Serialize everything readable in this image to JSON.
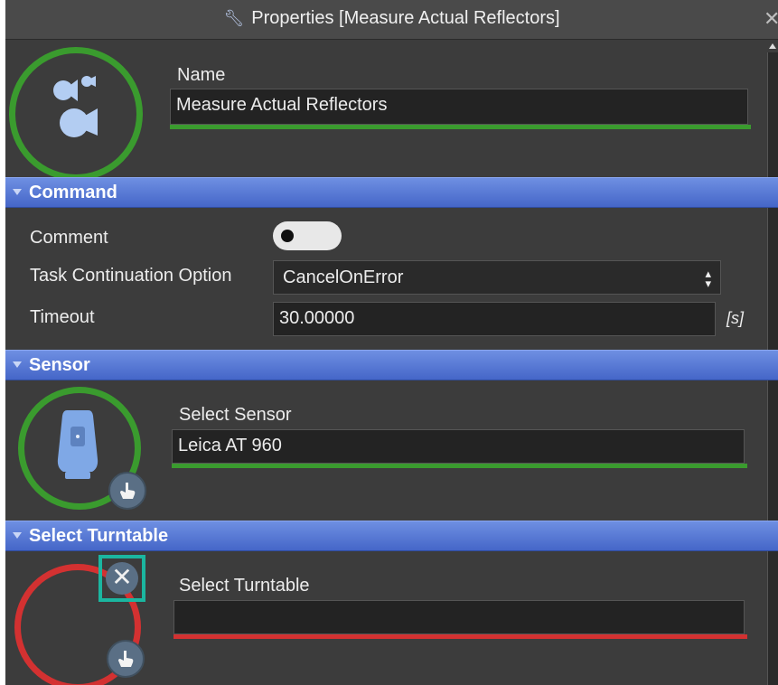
{
  "window": {
    "title": "Properties [Measure Actual Reflectors]",
    "close_glyph": "✕",
    "title_icon": "wrench-icon"
  },
  "header": {
    "name_label": "Name",
    "name_value": "Measure Actual Reflectors",
    "icon": "reflectors-icon",
    "status_color": "#3a9b2e"
  },
  "command": {
    "section_title": "Command",
    "comment_label": "Comment",
    "comment_enabled": false,
    "task_option_label": "Task Continuation Option",
    "task_option_value": "CancelOnError",
    "timeout_label": "Timeout",
    "timeout_value": "30.00000",
    "timeout_unit": "[s]"
  },
  "sensor": {
    "section_title": "Sensor",
    "select_label": "Select Sensor",
    "select_value": "Leica AT 960",
    "icon": "laser-tracker-icon",
    "status_color": "#3a9b2e"
  },
  "turntable": {
    "section_title": "Select Turntable",
    "select_label": "Select Turntable",
    "select_value": "",
    "status_color": "#d33131",
    "highlight_color": "#1bb6a0"
  },
  "colors": {
    "accent_blue": "#5577d6",
    "ok_green": "#3a9b2e",
    "error_red": "#d33131"
  }
}
